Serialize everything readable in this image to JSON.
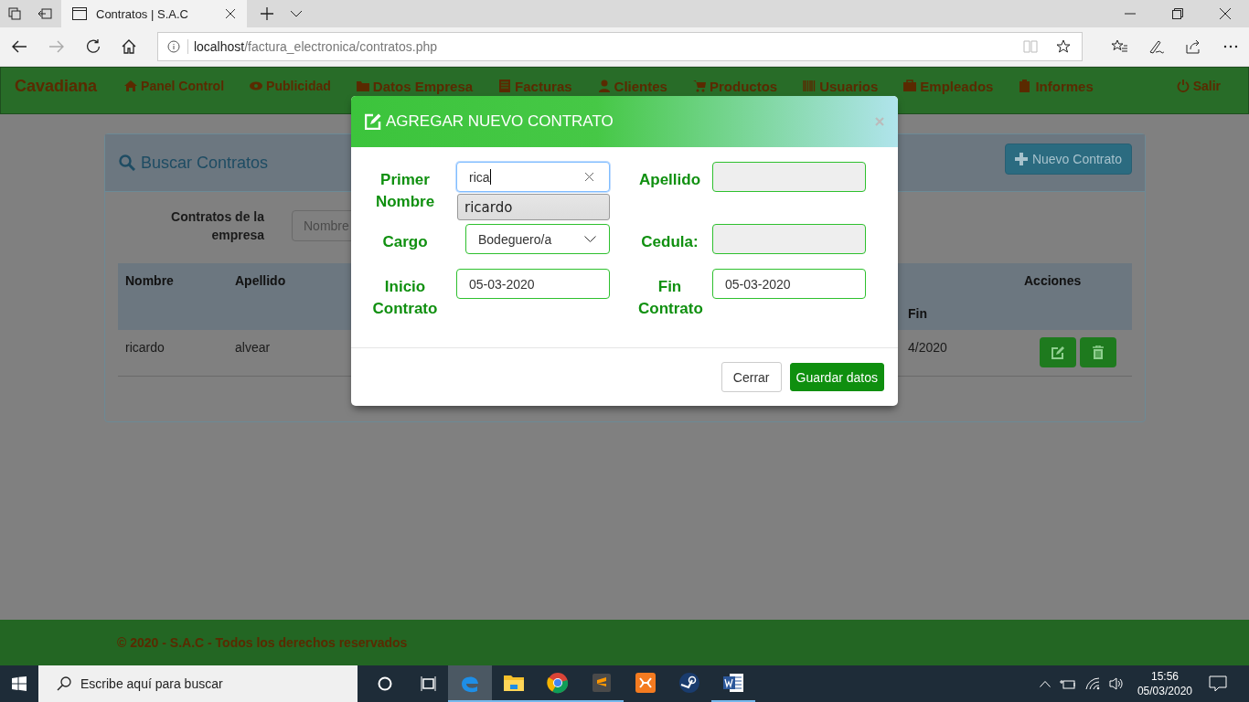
{
  "browser": {
    "tab_title": "Contratos | S.A.C",
    "url_host": "localhost",
    "url_path": "/factura_electronica/contratos.php"
  },
  "navbar": {
    "brand": "Cavadiana",
    "items": [
      {
        "label": "Panel Control"
      },
      {
        "label": "Publicidad"
      },
      {
        "label": "Datos Empresa"
      },
      {
        "label": "Facturas"
      },
      {
        "label": "Clientes"
      },
      {
        "label": "Productos"
      },
      {
        "label": "Usuarios"
      },
      {
        "label": "Empleados"
      },
      {
        "label": "Informes"
      }
    ],
    "logout": "Salir"
  },
  "search_panel": {
    "title": "Buscar Contratos",
    "new_button": "Nuevo Contrato",
    "filter_label": "Contratos de la empresa",
    "filter_placeholder": "Nombre"
  },
  "table": {
    "columns": [
      "Nombre",
      "Apellido",
      "Fin",
      "Acciones"
    ],
    "rows": [
      {
        "cells": [
          "ricardo",
          "alvear",
          "4/2020"
        ]
      }
    ]
  },
  "modal": {
    "title": "AGREGAR NUEVO CONTRATO",
    "fields": [
      {
        "label": "Primer Nombre",
        "kind": "autocomplete",
        "value": "rica",
        "suggestion": "ricardo",
        "disabled": false
      },
      {
        "label": "Apellido",
        "kind": "text",
        "disabled": true
      },
      {
        "label": "Cargo",
        "kind": "select",
        "value": "Bodeguero/a",
        "disabled": false
      },
      {
        "label": "Cedula:",
        "kind": "text",
        "disabled": true
      },
      {
        "label": "Inicio Contrato",
        "kind": "date",
        "value": "05-03-2020",
        "disabled": false
      },
      {
        "label": "Fin Contrato",
        "kind": "date",
        "value": "05-03-2020",
        "disabled": false
      }
    ],
    "buttons": [
      "Cerrar",
      "Guardar datos"
    ]
  },
  "footer": "© 2020 - S.A.C - Todos los derechos reservados",
  "taskbar": {
    "search_placeholder": "Escribe aquí para buscar",
    "apps": [
      {
        "active": true,
        "running": true
      },
      {
        "active": false,
        "running": true
      },
      {
        "active": false,
        "running": true
      },
      {
        "active": false,
        "running": true
      },
      {
        "active": false,
        "running": false
      },
      {
        "active": false,
        "running": false
      },
      {
        "active": false,
        "running": true
      }
    ],
    "time": "15:56",
    "date": "05/03/2020"
  }
}
